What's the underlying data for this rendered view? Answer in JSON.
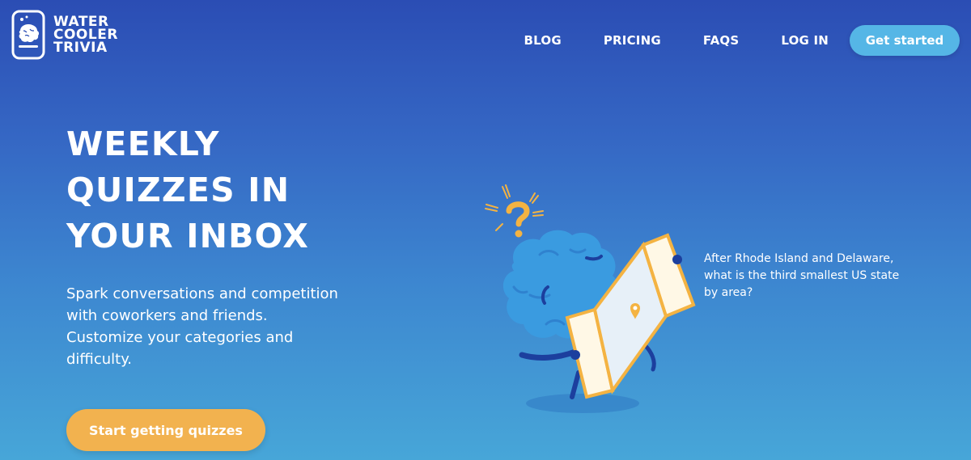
{
  "brand": {
    "line1": "WATER",
    "line2": "COOLER",
    "line3": "TRIVIA",
    "logo_icon": "water-cooler-brain-icon"
  },
  "nav": {
    "items": [
      {
        "label": "BLOG"
      },
      {
        "label": "PRICING"
      },
      {
        "label": "FAQS"
      },
      {
        "label": "LOG IN"
      }
    ],
    "cta_label": "Get started"
  },
  "hero": {
    "title_lines": [
      "WEEKLY",
      "QUIZZES IN",
      "YOUR INBOX"
    ],
    "subtitle_lines": [
      "Spark conversations and competition",
      "with coworkers and friends.",
      "Customize your categories and",
      "difficulty."
    ],
    "cta_label": "Start getting quizzes"
  },
  "illustration": {
    "icon": "brain-mascot-with-map-icon",
    "question_lines": [
      "After Rhode Island and Delaware,",
      "what is the third smallest US state",
      "by area?"
    ]
  },
  "colors": {
    "bg_top": "#2b4db4",
    "bg_bottom": "#47a6d8",
    "nav_button": "#55b6e6",
    "cta_button": "#f2b24f",
    "mascot": "#3a9be0",
    "accent_yellow": "#f4b342"
  }
}
